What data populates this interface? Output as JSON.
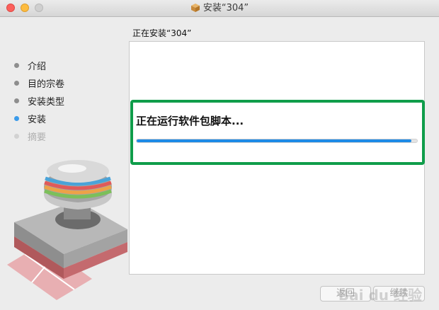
{
  "window": {
    "title": "安装“304”"
  },
  "header": {
    "section_title": "正在安装“304”"
  },
  "steps": [
    {
      "label": "介绍",
      "state": "done"
    },
    {
      "label": "目的宗卷",
      "state": "done"
    },
    {
      "label": "安装类型",
      "state": "done"
    },
    {
      "label": "安装",
      "state": "active"
    },
    {
      "label": "摘要",
      "state": "disabled"
    }
  ],
  "install": {
    "status_text": "正在运行软件包脚本...",
    "progress": 0.98
  },
  "buttons": {
    "back_label": "返回",
    "continue_label": "继续"
  },
  "watermark": "Bai du 经验",
  "colors": {
    "accent": "#1d8ae6",
    "highlight": "#0f9d4a",
    "close": "#fc605c",
    "minimize": "#fdbc40"
  }
}
